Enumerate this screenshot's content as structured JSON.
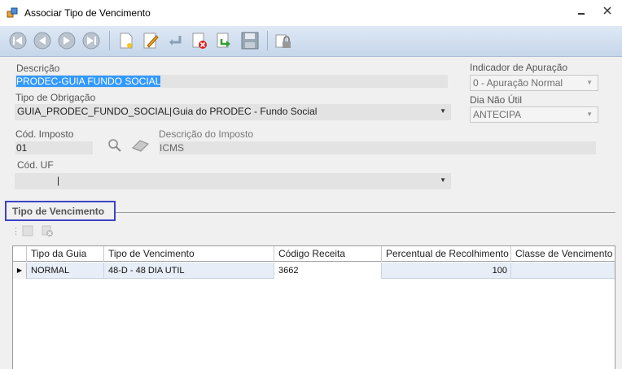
{
  "window": {
    "title": "Associar Tipo de Vencimento",
    "minimize_icon": "minimize-icon",
    "close_icon": "close-icon"
  },
  "toolbar": {
    "buttons": [
      {
        "name": "first-record-button",
        "icon": "first-icon"
      },
      {
        "name": "previous-record-button",
        "icon": "previous-icon"
      },
      {
        "name": "next-record-button",
        "icon": "next-icon"
      },
      {
        "name": "last-record-button",
        "icon": "last-icon"
      },
      {
        "name": "new-button",
        "icon": "new-document-icon"
      },
      {
        "name": "edit-button",
        "icon": "pencil-icon"
      },
      {
        "name": "undo-button",
        "icon": "undo-icon"
      },
      {
        "name": "delete-button",
        "icon": "delete-icon"
      },
      {
        "name": "confirm-button",
        "icon": "confirm-arrow-icon"
      },
      {
        "name": "save-button",
        "icon": "save-disk-icon"
      },
      {
        "name": "lock-button",
        "icon": "lock-icon"
      }
    ]
  },
  "form": {
    "descricao": {
      "label": "Descrição",
      "value": "PRODEC-GUIA FUNDO SOCIAL"
    },
    "tipo_obrigacao": {
      "label": "Tipo de Obrigação",
      "code": "GUIA_PRODEC_FUNDO_SOCIAL",
      "description": "Guia do PRODEC - Fundo Social"
    },
    "cod_imposto": {
      "label": "Cód. Imposto",
      "value": "01"
    },
    "descricao_imposto": {
      "label": "Descrição do Imposto",
      "value": "ICMS"
    },
    "cod_uf": {
      "label": "Cód. UF",
      "value": ""
    },
    "indicador_apuracao": {
      "label": "Indicador de Apuração",
      "value": "0 - Apuração Normal"
    },
    "dia_nao_util": {
      "label": "Dia Não Útil",
      "value": "ANTECIPA"
    }
  },
  "group": {
    "title": "Tipo de Vencimento"
  },
  "grid": {
    "columns": [
      "Tipo da Guia",
      "Tipo de Vencimento",
      "Código Receita",
      "Percentual de Recolhimento",
      "Classe de Vencimento"
    ],
    "rows": [
      {
        "tipo_guia": "NORMAL",
        "tipo_vencimento": "48-D - 48 DIA UTIL",
        "codigo_receita": "3662",
        "percentual": "100",
        "classe": ""
      }
    ]
  }
}
